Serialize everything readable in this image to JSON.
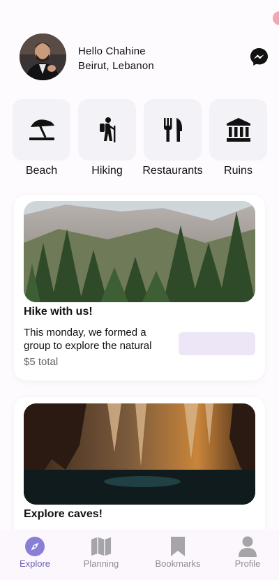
{
  "header": {
    "greeting": "Hello Chahine",
    "location": "Beirut, Lebanon"
  },
  "categories": [
    {
      "label": "Beach",
      "icon": "beach-umbrella-icon"
    },
    {
      "label": "Hiking",
      "icon": "hiker-icon"
    },
    {
      "label": "Restaurants",
      "icon": "fork-knife-icon"
    },
    {
      "label": "Ruins",
      "icon": "temple-icon"
    }
  ],
  "cards": [
    {
      "title": "Hike with us!",
      "description": "This monday, we formed a group to explore the natural",
      "price": "$5 total"
    },
    {
      "title": "Explore caves!"
    }
  ],
  "nav": [
    {
      "label": "Explore",
      "icon": "compass-icon",
      "active": true
    },
    {
      "label": "Planning",
      "icon": "map-icon",
      "active": false
    },
    {
      "label": "Bookmarks",
      "icon": "bookmark-icon",
      "active": false
    },
    {
      "label": "Profile",
      "icon": "person-icon",
      "active": false
    }
  ],
  "colors": {
    "accent": "#8a7fd6",
    "nav_inactive": "#a5a5a8",
    "tile_bg": "#f3f2f6",
    "button_bg": "#ece6f6"
  }
}
